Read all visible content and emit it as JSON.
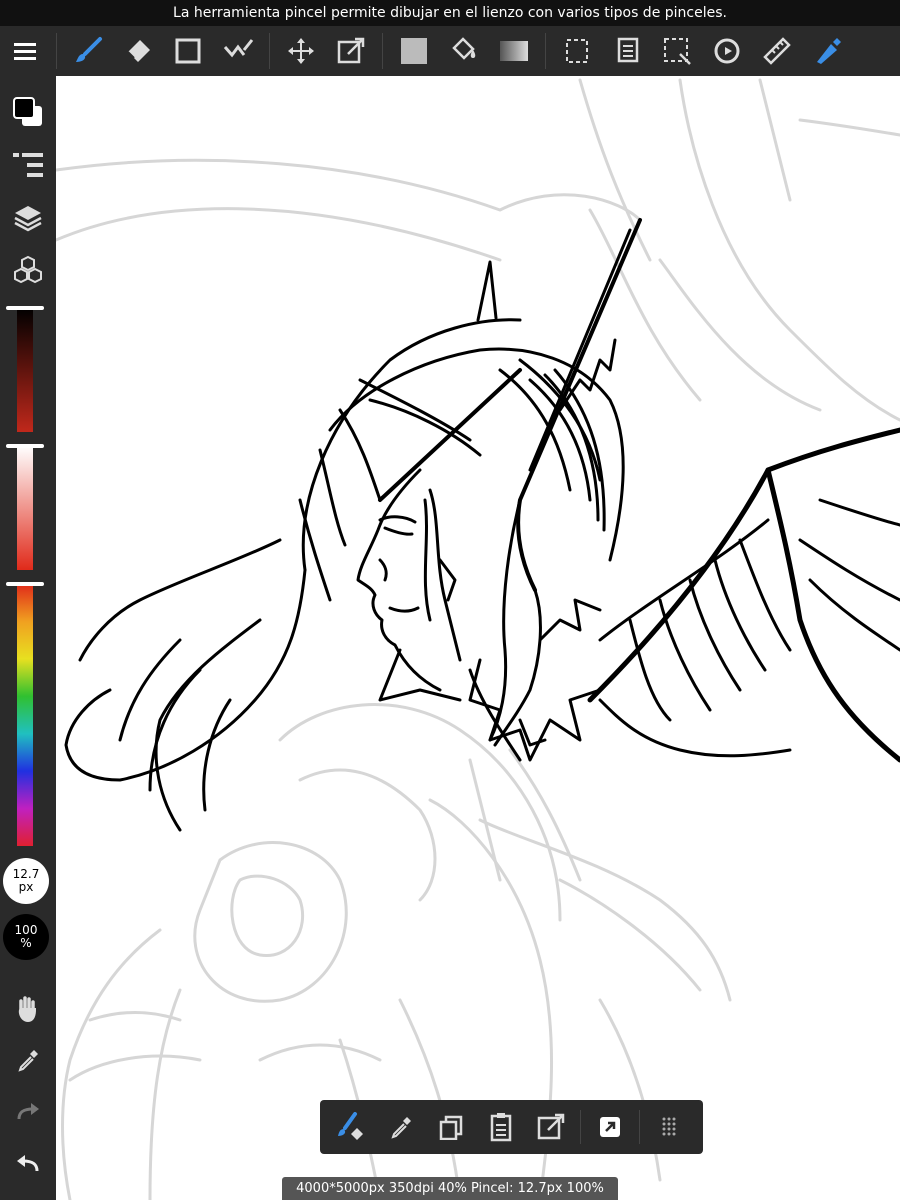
{
  "tooltip": "La herramienta pincel permite dibujar en el lienzo con varios tipos de pinceles.",
  "toolbar": {
    "tools": [
      "menu-icon",
      "brush-icon",
      "eraser-icon",
      "rectangle-icon",
      "smudge-icon",
      "move-icon",
      "transform-icon",
      "fill-color-icon",
      "bucket-icon",
      "gradient-icon",
      "select-icon",
      "copy-icon",
      "lasso-select-icon",
      "rotate-icon",
      "ruler-icon",
      "pen-icon"
    ],
    "active_tool": "brush-icon"
  },
  "sidebar": {
    "brush_size": {
      "value": "12.7",
      "unit": "px"
    },
    "opacity": {
      "value": "100",
      "unit": "%"
    }
  },
  "colors": {
    "accent": "#3a8ee6",
    "primary": "#000000",
    "secondary": "#ffffff",
    "hue": "#e0301e"
  },
  "bottom_bar": {
    "tools": [
      "brush-eraser-icon",
      "eyedropper-icon",
      "duplicate-layer-icon",
      "paste-icon",
      "export-icon",
      "quick-action-icon",
      "grip-icon"
    ]
  },
  "status": "4000*5000px 350dpi 40% Pincel: 12.7px 100%"
}
